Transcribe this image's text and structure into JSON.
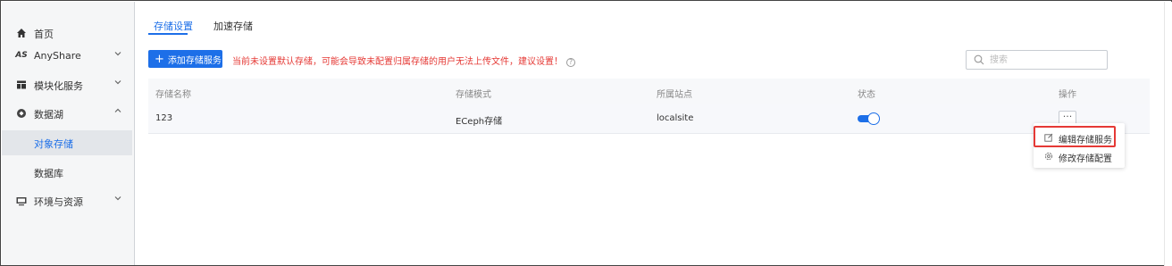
{
  "sidebar": {
    "items": [
      {
        "label": "首页",
        "icon": "home-icon"
      },
      {
        "label": "AnyShare",
        "icon": "anyshare-logo-icon",
        "logo_text": "AS"
      },
      {
        "label": "模块化服务",
        "icon": "module-icon"
      },
      {
        "label": "数据湖",
        "icon": "datalake-icon"
      },
      {
        "label": "对象存储",
        "active": true
      },
      {
        "label": "数据库"
      },
      {
        "label": "环境与资源",
        "icon": "environment-icon"
      }
    ]
  },
  "tabs": [
    {
      "label": "存储设置",
      "active": true
    },
    {
      "label": "加速存储",
      "active": false
    }
  ],
  "toolbar": {
    "add_label": "添加存储服务",
    "add_plus": "+",
    "warning": "当前未设置默认存储，可能会导致未配置归属存储的用户无法上传文件，建议设置！",
    "warning_help": "?"
  },
  "search": {
    "placeholder": "搜索"
  },
  "table": {
    "columns": [
      "存储名称",
      "存储模式",
      "所属站点",
      "状态",
      "操作"
    ],
    "rows": [
      {
        "name": "123",
        "mode": "ECeph存储",
        "site": "localsite",
        "enabled": true,
        "more": "···"
      }
    ]
  },
  "menu": {
    "items": [
      {
        "label": "编辑存储服务",
        "icon": "edit-icon",
        "highlighted": true
      },
      {
        "label": "修改存储配置",
        "icon": "gear-icon"
      }
    ]
  },
  "colors": {
    "accent": "#1d6fe8",
    "warning": "#e53935",
    "highlight_border": "#e53935"
  }
}
